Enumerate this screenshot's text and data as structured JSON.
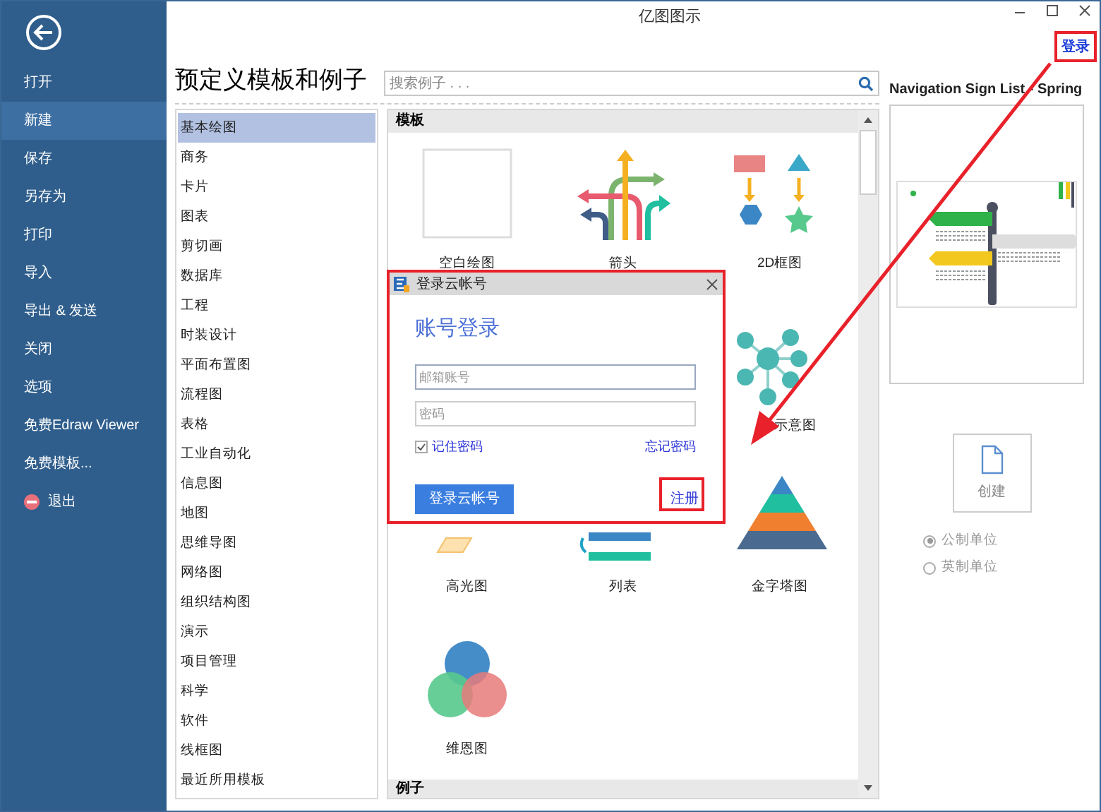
{
  "window": {
    "title": "亿图图示"
  },
  "sidebar": {
    "items": [
      {
        "label": "打开",
        "selected": false,
        "kind": "plain"
      },
      {
        "label": "新建",
        "selected": true,
        "kind": "plain"
      },
      {
        "label": "保存",
        "selected": false,
        "kind": "plain"
      },
      {
        "label": "另存为",
        "selected": false,
        "kind": "plain"
      },
      {
        "label": "打印",
        "selected": false,
        "kind": "plain"
      },
      {
        "label": "导入",
        "selected": false,
        "kind": "plain"
      },
      {
        "label": "导出 & 发送",
        "selected": false,
        "kind": "plain"
      },
      {
        "label": "关闭",
        "selected": false,
        "kind": "plain"
      },
      {
        "label": "选项",
        "selected": false,
        "kind": "plain"
      },
      {
        "label": "免费Edraw Viewer",
        "selected": false,
        "kind": "plain"
      },
      {
        "label": "免费模板...",
        "selected": false,
        "kind": "plain"
      },
      {
        "label": "退出",
        "selected": false,
        "kind": "exit"
      }
    ]
  },
  "heading": "预定义模板和例子",
  "search": {
    "placeholder": "搜索例子 . . ."
  },
  "categories": [
    {
      "label": "基本绘图",
      "selected": true
    },
    {
      "label": "商务",
      "selected": false
    },
    {
      "label": "卡片",
      "selected": false
    },
    {
      "label": "图表",
      "selected": false
    },
    {
      "label": "剪切画",
      "selected": false
    },
    {
      "label": "数据库",
      "selected": false
    },
    {
      "label": "工程",
      "selected": false
    },
    {
      "label": "时装设计",
      "selected": false
    },
    {
      "label": "平面布置图",
      "selected": false
    },
    {
      "label": "流程图",
      "selected": false
    },
    {
      "label": "表格",
      "selected": false
    },
    {
      "label": "工业自动化",
      "selected": false
    },
    {
      "label": "信息图",
      "selected": false
    },
    {
      "label": "地图",
      "selected": false
    },
    {
      "label": "思维导图",
      "selected": false
    },
    {
      "label": "网络图",
      "selected": false
    },
    {
      "label": "组织结构图",
      "selected": false
    },
    {
      "label": "演示",
      "selected": false
    },
    {
      "label": "项目管理",
      "selected": false
    },
    {
      "label": "科学",
      "selected": false
    },
    {
      "label": "软件",
      "selected": false
    },
    {
      "label": "线框图",
      "selected": false
    },
    {
      "label": "最近所用模板",
      "selected": false
    }
  ],
  "templates": {
    "section": "模板",
    "next_section": "例子",
    "items": [
      {
        "label": "空白绘图",
        "kind": "blank"
      },
      {
        "label": "箭头",
        "kind": "arrows"
      },
      {
        "label": "2D框图",
        "kind": "block"
      },
      {
        "kind": "covered"
      },
      {
        "kind": "covered"
      },
      {
        "label": "示意图",
        "kind": "network"
      },
      {
        "label": "高光图",
        "kind": "highlight"
      },
      {
        "label": "列表",
        "kind": "list"
      },
      {
        "label": "金字塔图",
        "kind": "pyramid"
      },
      {
        "label": "维恩图",
        "kind": "venn"
      }
    ]
  },
  "right_panel": {
    "login_link": "登录",
    "preview_title": "Navigation Sign List - Spring",
    "create_button": "创建",
    "units": [
      {
        "label": "公制单位",
        "selected": true
      },
      {
        "label": "英制单位",
        "selected": false
      }
    ]
  },
  "dialog": {
    "title": "登录云帐号",
    "heading": "账号登录",
    "account_placeholder": "邮箱账号",
    "password_placeholder": "密码",
    "remember": {
      "label": "记住密码",
      "checked": true
    },
    "forgot_link": "忘记密码",
    "submit_button": "登录云帐号",
    "register_link": "注册"
  }
}
